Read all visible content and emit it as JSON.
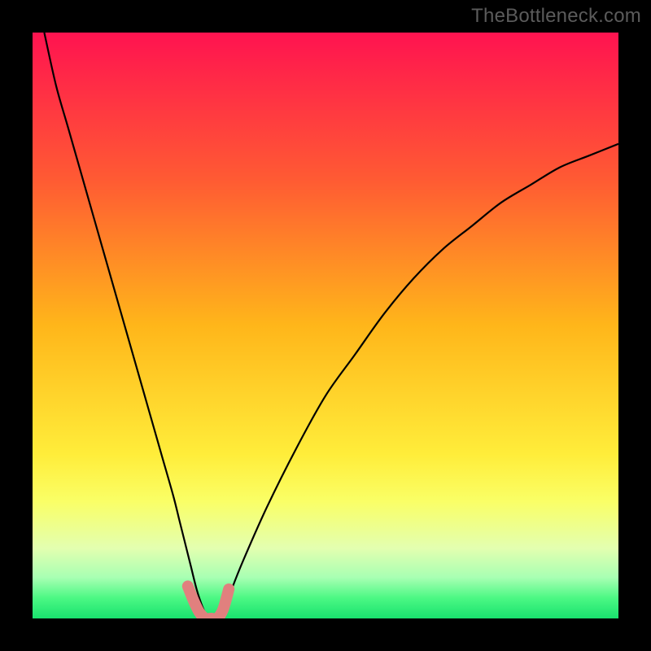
{
  "watermark": "TheBottleneck.com",
  "chart_data": {
    "type": "line",
    "title": "",
    "xlabel": "",
    "ylabel": "",
    "xlim": [
      0,
      100
    ],
    "ylim": [
      0,
      100
    ],
    "grid": false,
    "legend": false,
    "gradient_stops": [
      {
        "offset": 0,
        "color": "#ff1350"
      },
      {
        "offset": 0.25,
        "color": "#ff5a33"
      },
      {
        "offset": 0.5,
        "color": "#ffb61a"
      },
      {
        "offset": 0.72,
        "color": "#ffed3a"
      },
      {
        "offset": 0.8,
        "color": "#faff66"
      },
      {
        "offset": 0.88,
        "color": "#e3ffb0"
      },
      {
        "offset": 0.93,
        "color": "#a8ffb3"
      },
      {
        "offset": 0.965,
        "color": "#4cf884"
      },
      {
        "offset": 1.0,
        "color": "#19e26e"
      }
    ],
    "series": [
      {
        "name": "bottleneck-curve",
        "stroke": "#000000",
        "x": [
          2,
          4,
          6,
          8,
          10,
          12,
          14,
          16,
          18,
          20,
          22,
          24,
          25,
          26,
          27,
          28,
          29,
          30,
          31,
          32,
          33,
          34,
          36,
          40,
          45,
          50,
          55,
          60,
          65,
          70,
          75,
          80,
          85,
          90,
          95,
          100
        ],
        "values": [
          100,
          91,
          84,
          77,
          70,
          63,
          56,
          49,
          42,
          35,
          28,
          21,
          17,
          13,
          9,
          5,
          2,
          0,
          0,
          0,
          2,
          5,
          10,
          19,
          29,
          38,
          45,
          52,
          58,
          63,
          67,
          71,
          74,
          77,
          79,
          81
        ]
      },
      {
        "name": "highlight-foot",
        "stroke": "#e1807e",
        "stroke_width": 14,
        "linecap": "round",
        "x": [
          26.5,
          27.5,
          28.5,
          29.5,
          30.5,
          31.5,
          32.5,
          33.5
        ],
        "values": [
          5.5,
          3.0,
          1.0,
          0.0,
          0.0,
          0.0,
          1.5,
          5.0
        ]
      }
    ]
  }
}
